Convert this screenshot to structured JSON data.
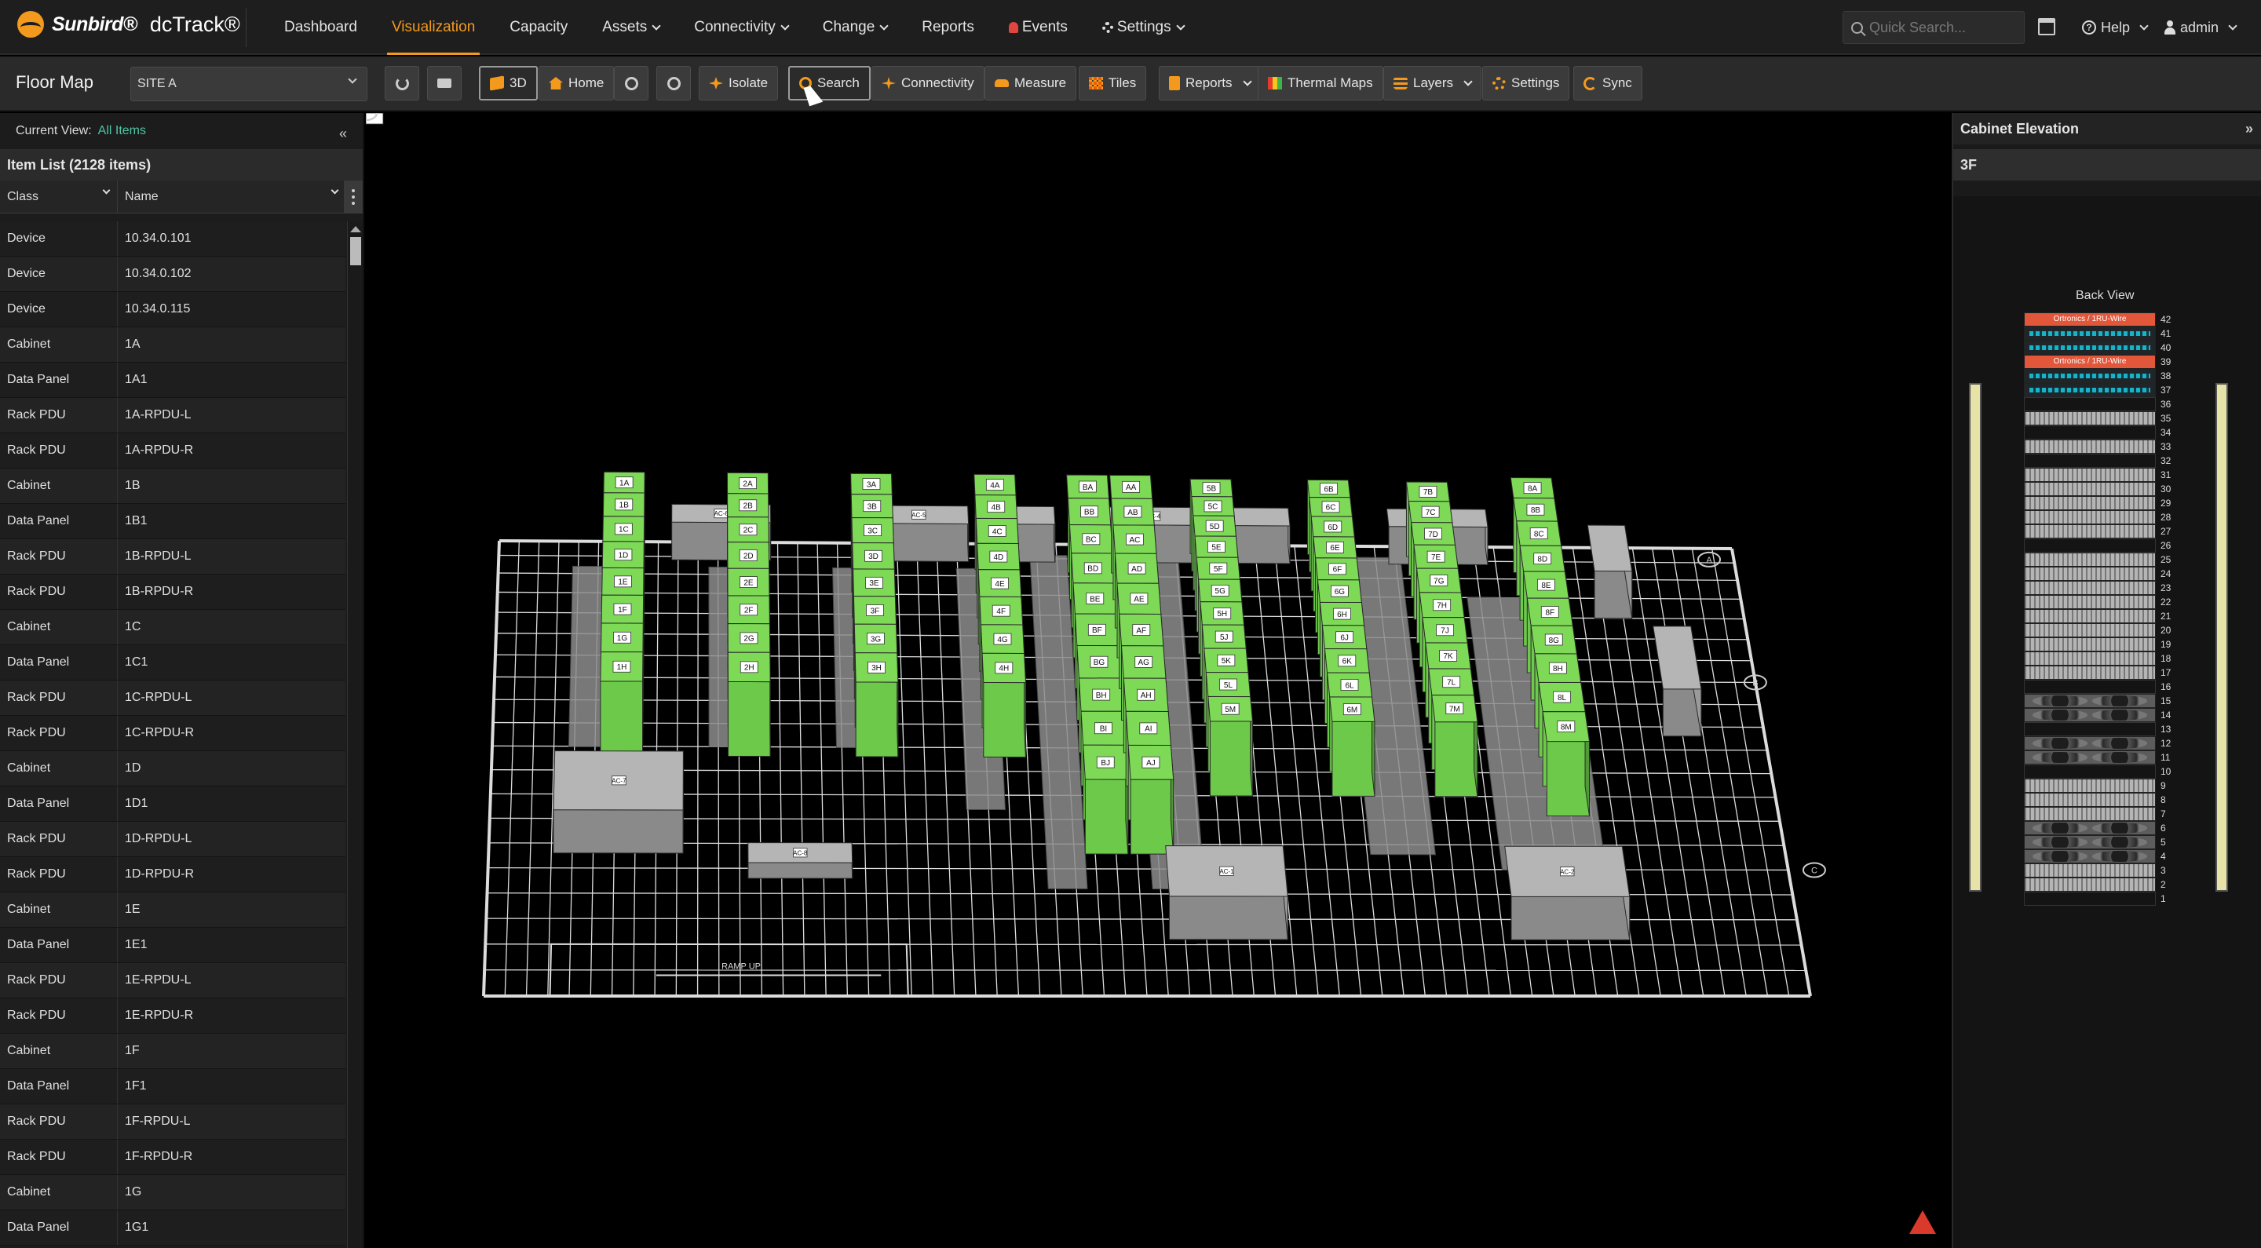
{
  "brand": {
    "company": "Sunbird®",
    "product": "dcTrack®"
  },
  "nav": {
    "items": [
      {
        "label": "Dashboard",
        "dropdown": false
      },
      {
        "label": "Visualization",
        "dropdown": false,
        "active": true
      },
      {
        "label": "Capacity",
        "dropdown": false
      },
      {
        "label": "Assets",
        "dropdown": true
      },
      {
        "label": "Connectivity",
        "dropdown": true
      },
      {
        "label": "Change",
        "dropdown": true
      },
      {
        "label": "Reports",
        "dropdown": false
      },
      {
        "label": "Events",
        "dropdown": false,
        "icon": "bell-icon"
      },
      {
        "label": "Settings",
        "dropdown": true,
        "icon": "gear-icon"
      }
    ],
    "search_placeholder": "Quick Search...",
    "help_label": "Help",
    "user_label": "admin"
  },
  "toolbar": {
    "title": "Floor Map",
    "site": "SITE A",
    "buttons": {
      "view3d": "3D",
      "home": "Home",
      "isolate": "Isolate",
      "search": "Search",
      "connectivity": "Connectivity",
      "measure": "Measure",
      "tiles": "Tiles",
      "reports": "Reports",
      "thermal": "Thermal Maps",
      "layers": "Layers",
      "settings": "Settings",
      "sync": "Sync"
    }
  },
  "left": {
    "current_view_label": "Current View:",
    "current_view_value": "All Items",
    "item_list_title": "Item List (2128 items)",
    "columns": [
      "Class",
      "Name"
    ],
    "rows": [
      [
        "Device",
        "10.34.0.101"
      ],
      [
        "Device",
        "10.34.0.102"
      ],
      [
        "Device",
        "10.34.0.115"
      ],
      [
        "Cabinet",
        "1A"
      ],
      [
        "Data Panel",
        "1A1"
      ],
      [
        "Rack PDU",
        "1A-RPDU-L"
      ],
      [
        "Rack PDU",
        "1A-RPDU-R"
      ],
      [
        "Cabinet",
        "1B"
      ],
      [
        "Data Panel",
        "1B1"
      ],
      [
        "Rack PDU",
        "1B-RPDU-L"
      ],
      [
        "Rack PDU",
        "1B-RPDU-R"
      ],
      [
        "Cabinet",
        "1C"
      ],
      [
        "Data Panel",
        "1C1"
      ],
      [
        "Rack PDU",
        "1C-RPDU-L"
      ],
      [
        "Rack PDU",
        "1C-RPDU-R"
      ],
      [
        "Cabinet",
        "1D"
      ],
      [
        "Data Panel",
        "1D1"
      ],
      [
        "Rack PDU",
        "1D-RPDU-L"
      ],
      [
        "Rack PDU",
        "1D-RPDU-R"
      ],
      [
        "Cabinet",
        "1E"
      ],
      [
        "Data Panel",
        "1E1"
      ],
      [
        "Rack PDU",
        "1E-RPDU-L"
      ],
      [
        "Rack PDU",
        "1E-RPDU-R"
      ],
      [
        "Cabinet",
        "1F"
      ],
      [
        "Data Panel",
        "1F1"
      ],
      [
        "Rack PDU",
        "1F-RPDU-L"
      ],
      [
        "Rack PDU",
        "1F-RPDU-R"
      ],
      [
        "Cabinet",
        "1G"
      ],
      [
        "Data Panel",
        "1G1"
      ]
    ]
  },
  "floor": {
    "ac_units": [
      "AC-6",
      "AC-5",
      "AC-4",
      "AC-3",
      "AC-7",
      "AC-8",
      "AC-1",
      "AC-2"
    ],
    "ramp_label": "RAMP UP",
    "grid_markers": [
      "5",
      "4",
      "3",
      "2",
      "1",
      "A",
      "B",
      "C"
    ],
    "rows": [
      [
        "1A",
        "1B",
        "1C",
        "1D",
        "1E",
        "1F",
        "1G",
        "1H"
      ],
      [
        "2A",
        "2B",
        "2C",
        "2D",
        "2E",
        "2F",
        "2G",
        "2H"
      ],
      [
        "3A",
        "3B",
        "3C",
        "3D",
        "3E",
        "3F",
        "3G",
        "3H"
      ],
      [
        "4A",
        "4B",
        "4C",
        "4D",
        "4E",
        "4F",
        "4G",
        "4H"
      ],
      [
        "BA",
        "BB",
        "BC",
        "BD",
        "BE",
        "BF",
        "BG",
        "BH",
        "BI",
        "BJ"
      ],
      [
        "AA",
        "AB",
        "AC",
        "AD",
        "AE",
        "AF",
        "AG",
        "AH",
        "AI",
        "AJ"
      ],
      [
        "5A",
        "5B",
        "5C",
        "5D",
        "5E",
        "5F",
        "5G",
        "5H",
        "5J",
        "5K",
        "5L",
        "5M"
      ],
      [
        "6A",
        "6B",
        "6C",
        "6D",
        "6E",
        "6F",
        "6G",
        "6H",
        "6J",
        "6K",
        "6L",
        "6M"
      ],
      [
        "7A",
        "7B",
        "7C",
        "7D",
        "7E",
        "7G",
        "7H",
        "7J",
        "7K",
        "7L",
        "7M"
      ],
      [
        "8A",
        "8B",
        "8C",
        "8D",
        "8E",
        "8F",
        "8G",
        "8H",
        "8L",
        "8M"
      ]
    ],
    "colors": {
      "cabinet": "#7ed957",
      "cabinet_side": "#4f9a37",
      "grey": "#9a9a9a",
      "grid": "#dcdcdc"
    }
  },
  "right": {
    "title": "Cabinet Elevation",
    "cabinet": "3F",
    "view": "Back View",
    "top_unit_label": "Ortronics / 1RU-Wire",
    "second_unit_label": "Ortronics / 1RU-Wire",
    "units_max": 42
  }
}
